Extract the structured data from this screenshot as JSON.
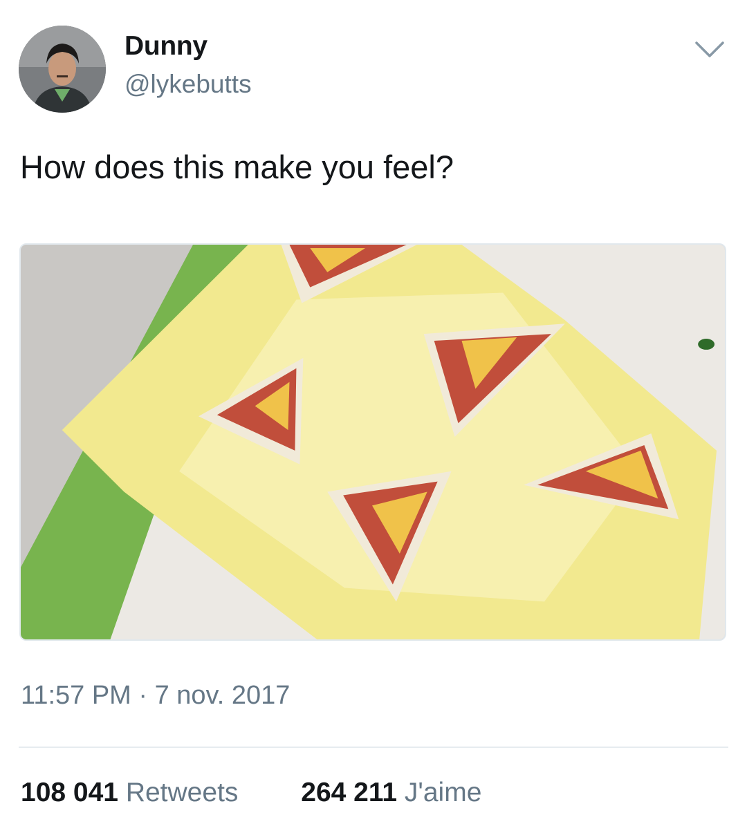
{
  "author": {
    "display_name": "Dunny",
    "handle": "@lykebutts"
  },
  "header": {
    "menu_icon": "chevron-down-icon"
  },
  "tweet": {
    "text": "How does this make you feel?",
    "timestamp": "11:57 PM · 7 nov. 2017"
  },
  "stats": {
    "retweets_count": "108 041",
    "retweets_label": "Retweets",
    "likes_count": "264 211",
    "likes_label": "J'aime"
  },
  "colors": {
    "primary_text": "#14171a",
    "secondary_text": "#657786",
    "divider": "#e6ecf0"
  }
}
